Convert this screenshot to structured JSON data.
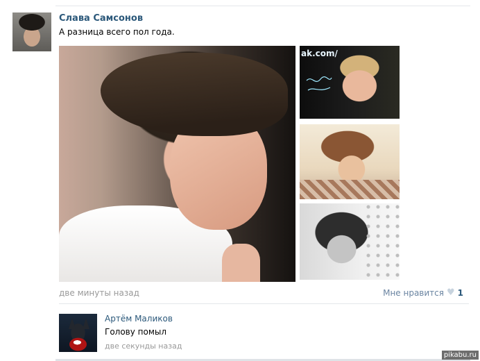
{
  "post": {
    "author": "Слава Самсонов",
    "text": "А разница всего пол года.",
    "time": "две минуты назад",
    "like_label": "Мне нравится",
    "like_count": "1"
  },
  "photos": {
    "thumb1_watermark": "ak.com/"
  },
  "comment": {
    "author": "Артём Маликов",
    "text": "Голову помыл",
    "time": "две секунды назад"
  },
  "site": {
    "watermark": "pikabu.ru"
  },
  "icons": {
    "like": "heart-icon"
  },
  "colors": {
    "link": "#2b587a",
    "muted": "#999999",
    "divider": "#e4e7ea"
  }
}
